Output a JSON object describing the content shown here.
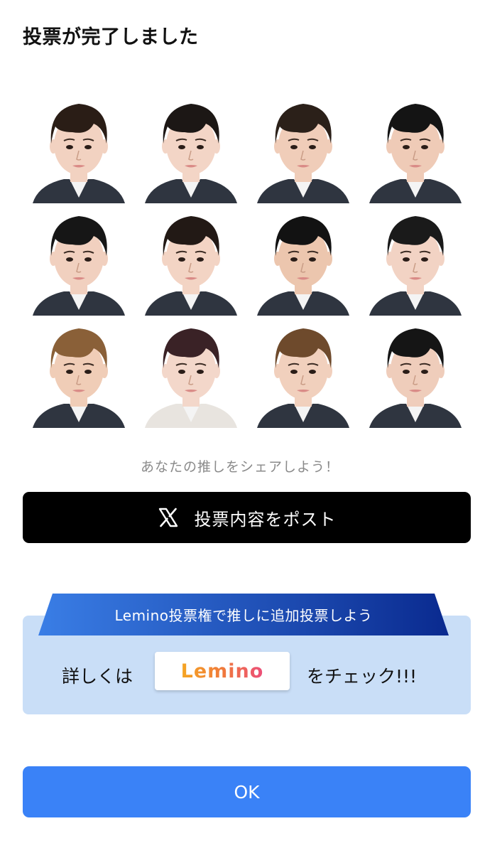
{
  "dialog": {
    "title": "投票が完了しました"
  },
  "members": [
    {
      "name": "member-1",
      "hair": "#2a1d16",
      "shirt": "#2f3540",
      "skin": "#f2d2c1"
    },
    {
      "name": "member-2",
      "hair": "#1c1715",
      "shirt": "#2f3540",
      "skin": "#f3d5c6"
    },
    {
      "name": "member-3",
      "hair": "#2b2019",
      "shirt": "#2f3540",
      "skin": "#f0cdb9"
    },
    {
      "name": "member-4",
      "hair": "#141414",
      "shirt": "#2f3540",
      "skin": "#efcbb7"
    },
    {
      "name": "member-5",
      "hair": "#161616",
      "shirt": "#2f3540",
      "skin": "#f1d0bf"
    },
    {
      "name": "member-6",
      "hair": "#221915",
      "shirt": "#2f3540",
      "skin": "#f3d4c4"
    },
    {
      "name": "member-7",
      "hair": "#121212",
      "shirt": "#2f3540",
      "skin": "#ecc6ae"
    },
    {
      "name": "member-8",
      "hair": "#1a1a1a",
      "shirt": "#2f3540",
      "skin": "#f2d3c4"
    },
    {
      "name": "member-9",
      "hair": "#8a6038",
      "shirt": "#2f3540",
      "skin": "#f0cdb7"
    },
    {
      "name": "member-10",
      "hair": "#3a2226",
      "shirt": "#e8e4df",
      "skin": "#f3d7ca"
    },
    {
      "name": "member-11",
      "hair": "#6e4a2c",
      "shirt": "#2f3540",
      "skin": "#f1d0bd"
    },
    {
      "name": "member-12",
      "hair": "#151515",
      "shirt": "#2f3540",
      "skin": "#efcdbb"
    }
  ],
  "share": {
    "caption": "あなたの推しをシェアしよう！",
    "post_label": "投票内容をポスト",
    "icon": "x-logo-icon"
  },
  "promo": {
    "banner_text": "Lemino投票権で推しに追加投票しよう",
    "before_text": "詳しくは",
    "logo_text": "Lemino",
    "after_text": "をチェック!!!",
    "banner_color_start": "#3a7ee6",
    "banner_color_end": "#0a2a8f",
    "box_color": "#c9def7"
  },
  "ok": {
    "label": "OK",
    "color": "#3a82f7"
  }
}
